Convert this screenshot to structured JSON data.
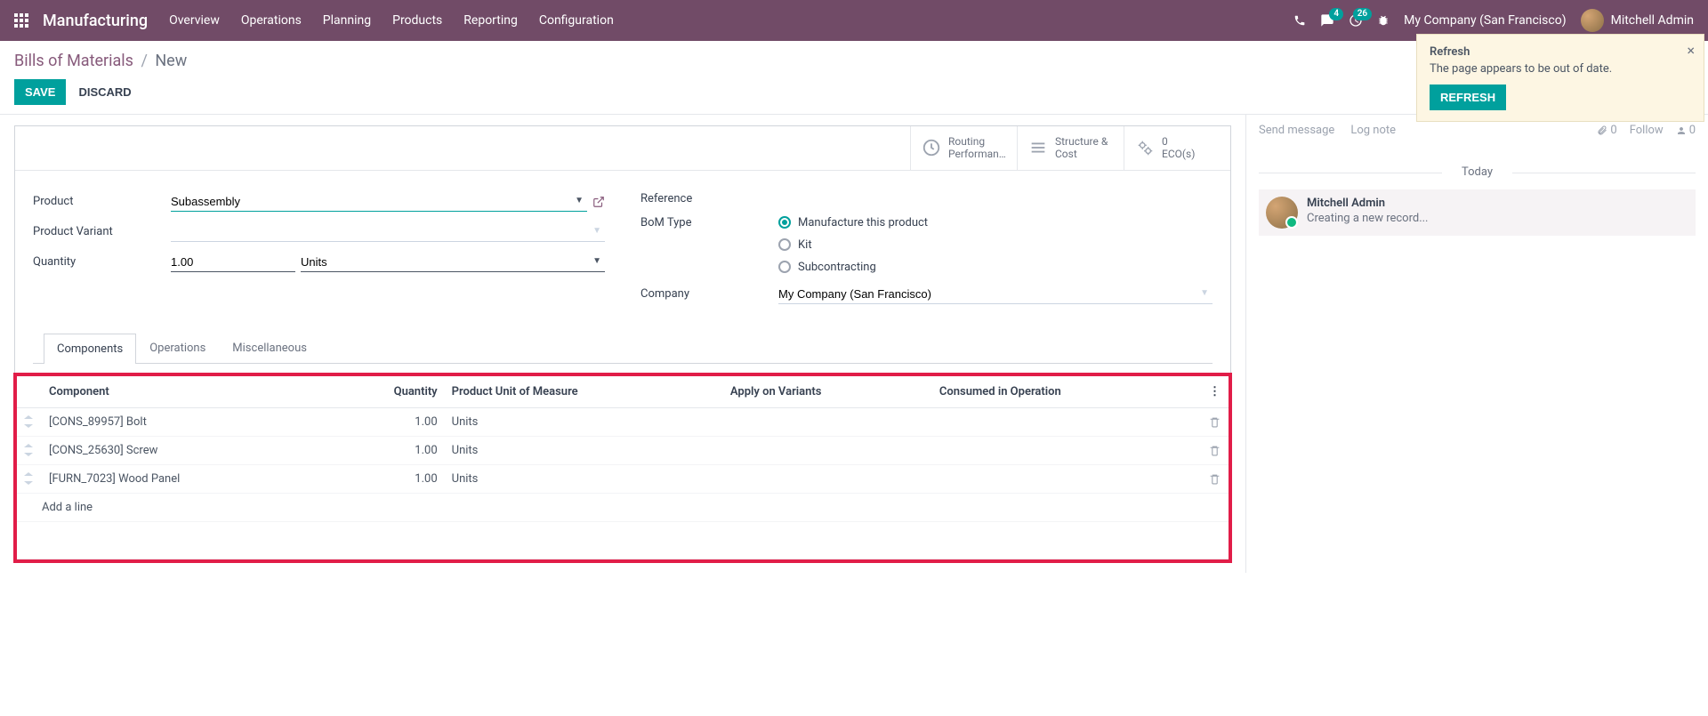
{
  "nav": {
    "brand": "Manufacturing",
    "items": [
      "Overview",
      "Operations",
      "Planning",
      "Products",
      "Reporting",
      "Configuration"
    ],
    "messages_badge": "4",
    "activities_badge": "26",
    "company": "My Company (San Francisco)",
    "user": "Mitchell Admin"
  },
  "notif": {
    "title": "Refresh",
    "body": "The page appears to be out of date.",
    "button": "REFRESH"
  },
  "breadcrumb": {
    "root": "Bills of Materials",
    "current": "New"
  },
  "actions": {
    "save": "SAVE",
    "discard": "DISCARD"
  },
  "stat": {
    "routing_l1": "Routing",
    "routing_l2": "Performan…",
    "structure_l1": "Structure &",
    "structure_l2": "Cost",
    "eco_val": "0",
    "eco_label": "ECO(s)"
  },
  "form": {
    "product_label": "Product",
    "product_value": "Subassembly",
    "variant_label": "Product Variant",
    "variant_value": "",
    "qty_label": "Quantity",
    "qty_value": "1.00",
    "uom_value": "Units",
    "reference_label": "Reference",
    "bom_type_label": "BoM Type",
    "bom_type_options": [
      "Manufacture this product",
      "Kit",
      "Subcontracting"
    ],
    "company_label": "Company",
    "company_value": "My Company (San Francisco)"
  },
  "tabs": [
    "Components",
    "Operations",
    "Miscellaneous"
  ],
  "table": {
    "headers": {
      "component": "Component",
      "quantity": "Quantity",
      "uom": "Product Unit of Measure",
      "variants": "Apply on Variants",
      "consumed": "Consumed in Operation"
    },
    "rows": [
      {
        "component": "[CONS_89957] Bolt",
        "qty": "1.00",
        "uom": "Units"
      },
      {
        "component": "[CONS_25630] Screw",
        "qty": "1.00",
        "uom": "Units"
      },
      {
        "component": "[FURN_7023] Wood Panel",
        "qty": "1.00",
        "uom": "Units"
      }
    ],
    "add_line": "Add a line"
  },
  "chatter": {
    "send": "Send message",
    "log": "Log note",
    "attach_count": "0",
    "follow": "Follow",
    "followers": "0",
    "today": "Today",
    "author": "Mitchell Admin",
    "text": "Creating a new record..."
  }
}
